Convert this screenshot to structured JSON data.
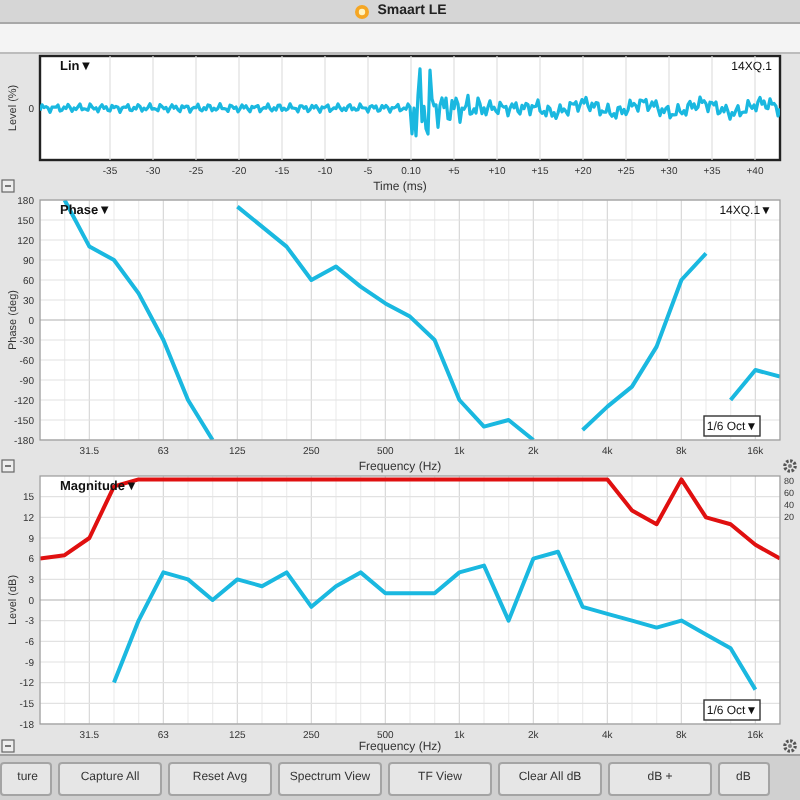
{
  "window": {
    "title": "Smaart LE"
  },
  "time_plot": {
    "mode_label": "Lin▼",
    "trace_label": "14XQ.1",
    "xlabel": "Time (ms)",
    "ylabel": "Level (%)",
    "zero_label": "0",
    "tick_labels": [
      "-35",
      "-30",
      "-25",
      "-20",
      "-15",
      "-10",
      "-5",
      "0.10",
      "+5",
      "+10",
      "+15",
      "+20",
      "+25",
      "+30",
      "+35",
      "+40"
    ]
  },
  "phase_plot": {
    "mode_label": "Phase▼",
    "trace_label": "14XQ.1▼",
    "smoothing": "1/6 Oct▼",
    "chart_data": {
      "type": "line",
      "grid": true,
      "xlabel": "Frequency (Hz)",
      "ylabel": "Phase (deg)",
      "ylim": [
        -180,
        180
      ],
      "categories": [
        null,
        null,
        "31.5",
        null,
        null,
        "63",
        null,
        null,
        "125",
        null,
        null,
        "250",
        null,
        null,
        "500",
        null,
        null,
        "1k",
        null,
        null,
        "2k",
        null,
        null,
        "4k",
        null,
        null,
        "8k",
        null,
        null,
        "16k",
        null
      ],
      "yticks": [
        180,
        150,
        120,
        90,
        60,
        30,
        0,
        -30,
        -60,
        -90,
        -120,
        -150,
        -180
      ],
      "series": [
        {
          "color": "#1ab8e0",
          "values": [
            null,
            180,
            110,
            90,
            40,
            -30,
            -120,
            -180,
            170,
            140,
            110,
            60,
            80,
            50,
            25,
            5,
            -30,
            -120,
            -160,
            -150,
            -180,
            null,
            -165,
            -130,
            -100,
            -40,
            60,
            100,
            -120,
            -75,
            -85
          ]
        }
      ]
    }
  },
  "magnitude_plot": {
    "mode_label": "Magnitude▼",
    "smoothing": "1/6 Oct▼",
    "coherence_scale": [
      "80",
      "60",
      "40",
      "20"
    ],
    "chart_data": {
      "type": "line",
      "grid": true,
      "xlabel": "Frequency (Hz)",
      "ylabel": "Level (dB)",
      "ylim": [
        -18,
        18
      ],
      "categories": [
        null,
        null,
        "31.5",
        null,
        null,
        "63",
        null,
        null,
        "125",
        null,
        null,
        "250",
        null,
        null,
        "500",
        null,
        null,
        "1k",
        null,
        null,
        "2k",
        null,
        null,
        "4k",
        null,
        null,
        "8k",
        null,
        null,
        "16k",
        null
      ],
      "yticks": [
        15,
        12,
        9,
        6,
        3,
        0,
        -3,
        -6,
        -9,
        -12,
        -15,
        -18
      ],
      "series": [
        {
          "color": "#e01010",
          "values": [
            6,
            6.5,
            9,
            16.5,
            17.5,
            17.5,
            17.5,
            17.5,
            17.5,
            17.5,
            17.5,
            17.5,
            17.5,
            17.5,
            17.5,
            17.5,
            17.5,
            17.5,
            17.5,
            17.5,
            17.5,
            17.5,
            17.5,
            17.5,
            13,
            11,
            17.5,
            12,
            11,
            8,
            6
          ]
        },
        {
          "color": "#1ab8e0",
          "values": [
            null,
            null,
            null,
            -12,
            -3,
            4,
            3,
            0,
            3,
            2,
            4,
            -1,
            2,
            4,
            1,
            1,
            1,
            4,
            5,
            -3,
            6,
            7,
            -1,
            -2,
            -3,
            -4,
            -3,
            -5,
            -7,
            -13,
            null
          ]
        }
      ]
    }
  },
  "buttons": [
    "ture",
    "Capture All",
    "Reset Avg",
    "Spectrum View",
    "TF View",
    "Clear All dB",
    "dB +",
    "dB"
  ]
}
